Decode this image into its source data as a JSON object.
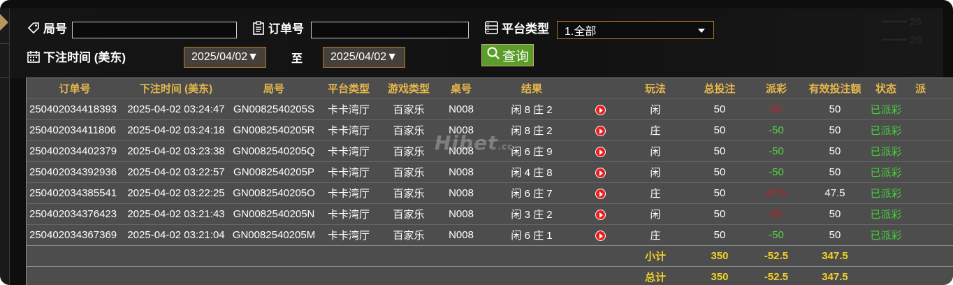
{
  "filters": {
    "round_label": "局号",
    "round_value": "",
    "order_label": "订单号",
    "order_value": "",
    "platform_label": "平台类型",
    "platform_selected": "1.全部",
    "bet_time_label": "下注时间 (美东)",
    "date_from": "2025/04/02▼",
    "to_label": "至",
    "date_to": "2025/04/02▼",
    "query_label": "查询"
  },
  "table": {
    "headers": [
      "订单号",
      "下注时间 (美东)",
      "局号",
      "平台类型",
      "游戏类型",
      "桌号",
      "结果",
      "",
      "玩法",
      "总投注",
      "派彩",
      "有效投注额",
      "状态",
      "派"
    ],
    "rows": [
      {
        "order": "250402034418393",
        "time": "2025-04-02 03:24:47",
        "round": "GN0082540205S",
        "platform": "卡卡湾厅",
        "game": "百家乐",
        "table": "N008",
        "result": "闲 8 庄 2",
        "play": "闲",
        "bet": "50",
        "payout": "50",
        "payout_color": "red",
        "valid": "50",
        "status": "已派彩"
      },
      {
        "order": "250402034411806",
        "time": "2025-04-02 03:24:18",
        "round": "GN0082540205R",
        "platform": "卡卡湾厅",
        "game": "百家乐",
        "table": "N008",
        "result": "闲 8 庄 2",
        "play": "庄",
        "bet": "50",
        "payout": "-50",
        "payout_color": "green",
        "valid": "50",
        "status": "已派彩"
      },
      {
        "order": "250402034402379",
        "time": "2025-04-02 03:23:38",
        "round": "GN0082540205Q",
        "platform": "卡卡湾厅",
        "game": "百家乐",
        "table": "N008",
        "result": "闲 6 庄 9",
        "play": "闲",
        "bet": "50",
        "payout": "-50",
        "payout_color": "green",
        "valid": "50",
        "status": "已派彩"
      },
      {
        "order": "250402034392936",
        "time": "2025-04-02 03:22:57",
        "round": "GN0082540205P",
        "platform": "卡卡湾厅",
        "game": "百家乐",
        "table": "N008",
        "result": "闲 4 庄 8",
        "play": "闲",
        "bet": "50",
        "payout": "-50",
        "payout_color": "green",
        "valid": "50",
        "status": "已派彩"
      },
      {
        "order": "250402034385541",
        "time": "2025-04-02 03:22:25",
        "round": "GN0082540205O",
        "platform": "卡卡湾厅",
        "game": "百家乐",
        "table": "N008",
        "result": "闲 6 庄 7",
        "play": "庄",
        "bet": "50",
        "payout": "47.5",
        "payout_color": "red",
        "valid": "47.5",
        "status": "已派彩"
      },
      {
        "order": "250402034376423",
        "time": "2025-04-02 03:21:43",
        "round": "GN0082540205N",
        "platform": "卡卡湾厅",
        "game": "百家乐",
        "table": "N008",
        "result": "闲 3 庄 2",
        "play": "闲",
        "bet": "50",
        "payout": "50",
        "payout_color": "red",
        "valid": "50",
        "status": "已派彩"
      },
      {
        "order": "250402034367369",
        "time": "2025-04-02 03:21:04",
        "round": "GN0082540205M",
        "platform": "卡卡湾厅",
        "game": "百家乐",
        "table": "N008",
        "result": "闲 6 庄 1",
        "play": "庄",
        "bet": "50",
        "payout": "-50",
        "payout_color": "green",
        "valid": "50",
        "status": "已派彩"
      }
    ],
    "subtotal": {
      "label": "小计",
      "bet": "350",
      "payout": "-52.5",
      "valid": "347.5"
    },
    "total": {
      "label": "总计",
      "bet": "350",
      "payout": "-52.5",
      "valid": "347.5"
    }
  },
  "watermark": {
    "text": "Hibet",
    "suffix": ".cc"
  },
  "colors": {
    "header_text": "#e8b84a",
    "table_bg": "#4d4d4d",
    "win_red": "#c0212a",
    "loss_green": "#52d83f",
    "summary_yellow": "#f3d12b",
    "query_button": "#5a9d2a"
  }
}
